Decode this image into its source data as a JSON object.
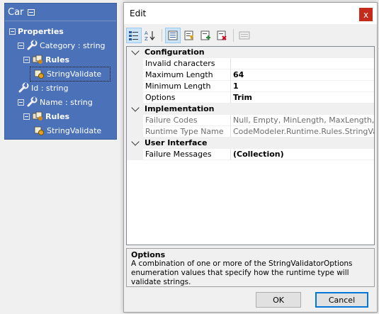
{
  "designer": {
    "title": "Car",
    "tree": [
      {
        "label": "Properties",
        "bold": true,
        "icon": "collapse-box",
        "indent": 0
      },
      {
        "label": "Category : string",
        "icon": "wrench-icon",
        "indent": 1
      },
      {
        "label": "Rules",
        "bold": true,
        "icon": "rules-icon",
        "indent": 2
      },
      {
        "label": "StringValidate",
        "icon": "rule-item-icon",
        "indent": 3,
        "selected": true
      },
      {
        "label": "Id : string",
        "icon": "wrench-icon",
        "indent": 1
      },
      {
        "label": "Name : string",
        "icon": "wrench-icon",
        "indent": 1
      },
      {
        "label": "Rules",
        "bold": true,
        "icon": "rules-icon",
        "indent": 2
      },
      {
        "label": "StringValidate",
        "icon": "rule-item-icon",
        "indent": 3
      }
    ]
  },
  "dialog": {
    "title": "Edit",
    "close_label": "x",
    "toolbar": [
      "categorized-icon",
      "alphabetical-icon",
      "properties-icon",
      "events-icon",
      "add-icon",
      "delete-icon",
      "property-pages-icon"
    ],
    "grid": {
      "categories": [
        {
          "name": "Configuration",
          "rows": [
            {
              "name": "Invalid characters",
              "value": "",
              "bold": false
            },
            {
              "name": "Maximum Length",
              "value": "64",
              "bold": true
            },
            {
              "name": "Minimum Length",
              "value": "1",
              "bold": true
            },
            {
              "name": "Options",
              "value": "Trim",
              "bold": true
            }
          ]
        },
        {
          "name": "Implementation",
          "readonly": true,
          "rows": [
            {
              "name": "Failure Codes",
              "value": "Null, Empty, MinLength, MaxLength, Inva",
              "bold": false
            },
            {
              "name": "Runtime Type Name",
              "value": "CodeModeler.Runtime.Rules.StringValidat",
              "bold": false
            }
          ]
        },
        {
          "name": "User Interface",
          "rows": [
            {
              "name": "Failure Messages",
              "value": "(Collection)",
              "bold": true
            }
          ]
        }
      ]
    },
    "help": {
      "title": "Options",
      "description": "A combination of one or more of the StringValidatorOptions enumeration values that specify how the runtime type will validate strings."
    },
    "ok_label": "OK",
    "cancel_label": "Cancel"
  }
}
